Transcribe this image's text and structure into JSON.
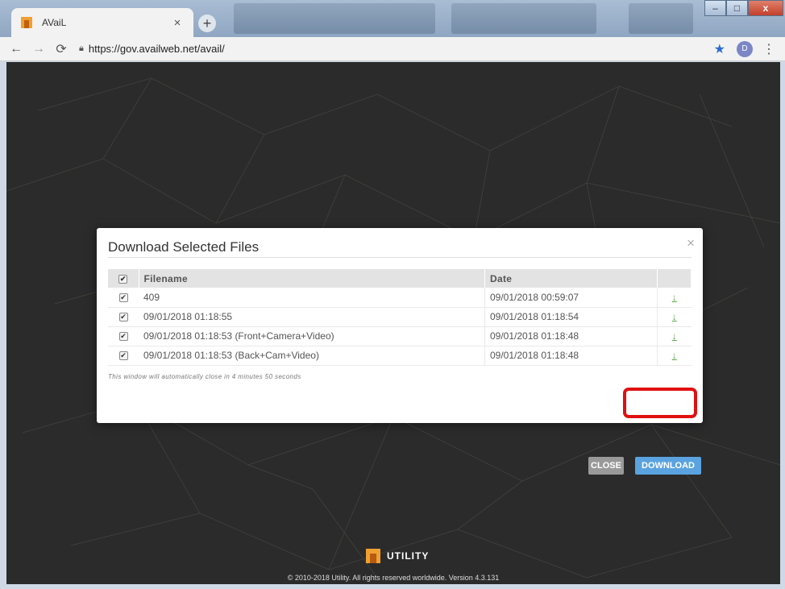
{
  "browser": {
    "tab_title": "AVaiL",
    "tab_close": "×",
    "new_tab": "+",
    "url": "https://gov.availweb.net/avail/",
    "avatar_letter": "D",
    "window_controls": {
      "min": "–",
      "max": "□",
      "close": "x"
    }
  },
  "modal": {
    "title": "Download Selected Files",
    "close_glyph": "×",
    "columns": {
      "filename": "Filename",
      "date": "Date"
    },
    "rows": [
      {
        "filename": "409",
        "date": "09/01/2018 00:59:07"
      },
      {
        "filename": "09/01/2018 01:18:55",
        "date": "09/01/2018 01:18:54"
      },
      {
        "filename": "09/01/2018 01:18:53 (Front+Camera+Video)",
        "date": "09/01/2018 01:18:48"
      },
      {
        "filename": "09/01/2018 01:18:53 (Back+Cam+Video)",
        "date": "09/01/2018 01:18:48"
      }
    ],
    "notice": "This window will automatically close in 4 minutes 50 seconds",
    "close_label": "CLOSE",
    "download_label": "DOWNLOAD"
  },
  "footer": {
    "brand": "UTILITY",
    "copyright": "© 2010-2018 Utility. All rights reserved worldwide. Version 4.3.131"
  },
  "colors": {
    "accent_download": "#5aa3e0",
    "highlight": "#e01010",
    "page_bg": "#2b2b2b"
  }
}
